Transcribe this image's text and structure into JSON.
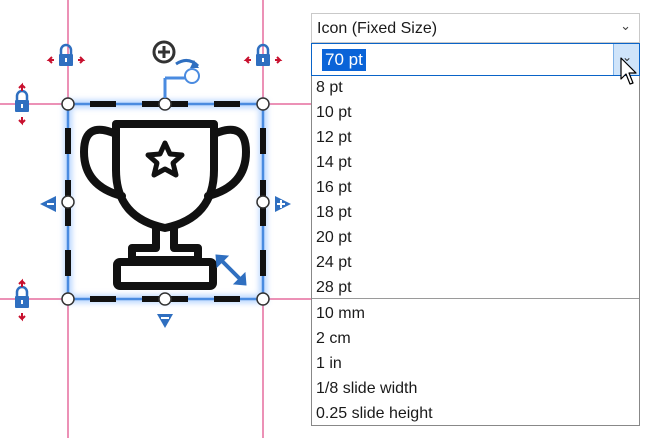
{
  "size_mode": {
    "value": "Icon (Fixed Size)",
    "icon": "chevron-down-icon"
  },
  "size_input": {
    "value": "70 pt",
    "icon": "chevron-down-icon"
  },
  "size_options": {
    "points": [
      "8 pt",
      "10 pt",
      "12 pt",
      "14 pt",
      "16 pt",
      "18 pt",
      "20 pt",
      "24 pt",
      "28 pt"
    ],
    "other": [
      "10 mm",
      "2 cm",
      "1 in",
      "1/8 slide width",
      "0.25 slide height"
    ]
  },
  "canvas": {
    "icon": "trophy-icon",
    "guide_color": "#d8236e",
    "selection_color": "#2f6fc0",
    "handle_icons": [
      "lock-icon",
      "rotate-icon",
      "resize-arrows-icon",
      "align-arrow-icon"
    ]
  },
  "cursor": {
    "icon": "mouse-pointer-icon"
  }
}
